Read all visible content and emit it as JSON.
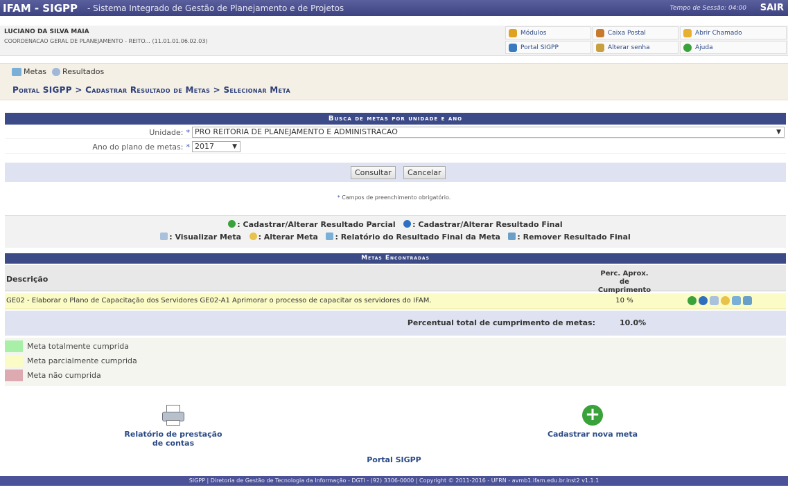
{
  "header": {
    "system": "IFAM - SIGPP",
    "description": "- Sistema Integrado de Gestão de Planejamento e de Projetos",
    "session": "Tempo de Sessão: 04:00",
    "logout": "SAIR"
  },
  "user": {
    "name": "LUCIANO DA SILVA MAIA",
    "unit": "COORDENACAO GERAL DE PLANEJAMENTO - REITO... (11.01.01.06.02.03)"
  },
  "quick_links": {
    "modulos": "Módulos",
    "caixa": "Caixa Postal",
    "chamado": "Abrir Chamado",
    "portal": "Portal SIGPP",
    "senha": "Alterar senha",
    "ajuda": "Ajuda"
  },
  "toolbar": {
    "metas": "Metas",
    "resultados": "Resultados"
  },
  "breadcrumb": "Portal SIGPP > Cadastrar Resultado de Metas > Selecionar Meta",
  "form": {
    "title": "Busca de metas por unidade e ano",
    "unidade_label": "Unidade:",
    "unidade_value": "PRO REITORIA DE PLANEJAMENTO E ADMINISTRACAO",
    "ano_label": "Ano do plano de metas:",
    "ano_value": "2017",
    "consultar": "Consultar",
    "cancelar": "Cancelar",
    "required_mark": "*",
    "required_note": "Campos de preenchimento obrigatório."
  },
  "legend": {
    "parcial": ": Cadastrar/Alterar Resultado Parcial",
    "final": ": Cadastrar/Alterar Resultado Final",
    "visualizar": ": Visualizar Meta",
    "alterar": ": Alterar Meta",
    "relatorio": ": Relatório do Resultado Final da Meta",
    "remover": ": Remover Resultado Final"
  },
  "results": {
    "title": "Metas Encontradas",
    "col_desc": "Descrição",
    "col_perc_1": "Perc. Aprox.",
    "col_perc_2": "de Cumprimento",
    "rows": [
      {
        "desc": "GE02 - Elaborar o Plano de Capacitação dos Servidores GE02-A1 Aprimorar o processo de capacitar os servidores do IFAM.",
        "perc": "10 %"
      }
    ],
    "total_label": "Percentual total de cumprimento de metas:",
    "total_value": "10.0%"
  },
  "status_legend": {
    "full": "Meta totalmente cumprida",
    "partial": "Meta parcialmente cumprida",
    "none": "Meta não cumprida",
    "colors": {
      "full": "#a8f0a8",
      "partial": "#fbfbc6",
      "none": "#dcaab0"
    }
  },
  "links": {
    "relatorio": "Relatório de prestação de contas",
    "nova_meta": "Cadastrar nova meta",
    "portal": "Portal SIGPP"
  },
  "footer": "SIGPP | Diretoria de Gestão de Tecnologia da Informação - DGTI - (92) 3306-0000 | Copyright © 2011-2016 - UFRN - avmb1.ifam.edu.br.inst2 v1.1.1"
}
